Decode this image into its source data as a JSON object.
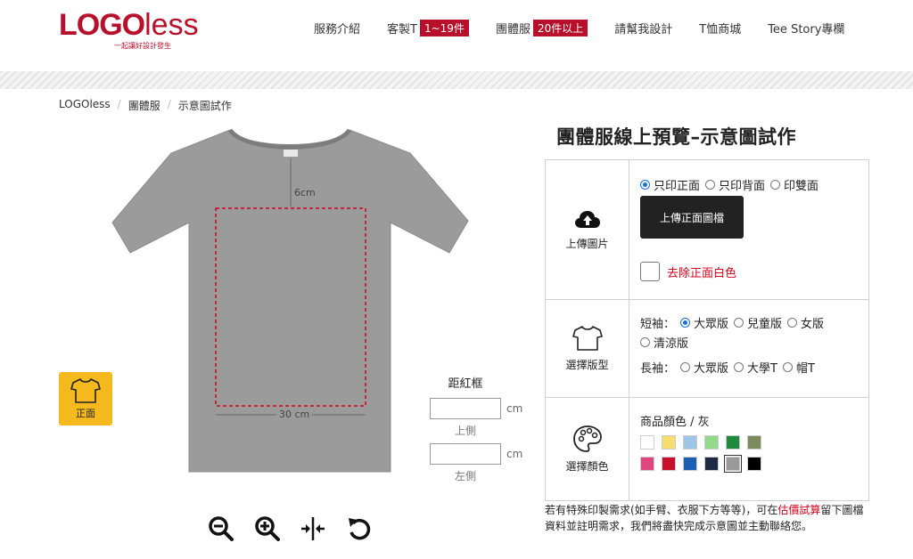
{
  "header": {
    "logo_main": "LOGO",
    "logo_less": "less",
    "logo_tagline": "一起讓好設計發生",
    "nav": [
      {
        "label": "服務介紹",
        "badge": ""
      },
      {
        "label": "客製T",
        "badge": "1~19件"
      },
      {
        "label": "團體服",
        "badge": "20件以上"
      },
      {
        "label": "請幫我設計",
        "badge": ""
      },
      {
        "label": "T恤商城",
        "badge": ""
      },
      {
        "label": "Tee Story專欄",
        "badge": ""
      }
    ]
  },
  "breadcrumb": [
    "LOGOless",
    "團體服",
    "示意圖試作"
  ],
  "preview": {
    "dim_top": "6cm",
    "dim_width": "30 cm",
    "front_label": "正面"
  },
  "margin": {
    "title": "距紅框",
    "unit": "cm",
    "top_label": "上側",
    "left_label": "左側"
  },
  "panel": {
    "title": "團體服線上預覽–示意圖試作",
    "upload": {
      "label": "上傳圖片",
      "options": [
        "只印正面",
        "只印背面",
        "印雙面"
      ],
      "selected": "只印正面",
      "button": "上傳正面圖檔",
      "remove_white": "去除正面白色"
    },
    "fit": {
      "label": "選擇版型",
      "short_sleeve_label": "短袖：",
      "short_options": [
        "大眾版",
        "兒童版",
        "女版",
        "清涼版"
      ],
      "short_selected": "大眾版",
      "long_sleeve_label": "長袖：",
      "long_options": [
        "大眾版",
        "大學T",
        "帽T"
      ]
    },
    "color": {
      "label": "選擇顏色",
      "current": "商品顏色 / 灰",
      "swatches_row1": [
        "#ffffff",
        "#f7dc6f",
        "#9fc5e8",
        "#93d98a",
        "#1e8a3e",
        "#7d8a5e"
      ],
      "swatches_row2": [
        "#e0457b",
        "#c8102e",
        "#1a5fb4",
        "#1c2a44",
        "#9a9a9a",
        "#000000"
      ],
      "selected_color": "#9a9a9a"
    }
  },
  "note": {
    "before": "若有特殊印製需求(如手臂、衣服下方等等)，可在",
    "link": "估價試算",
    "after": "留下圖檔資料並註明需求，我們將盡快完成示意圖並主動聯絡您。"
  }
}
